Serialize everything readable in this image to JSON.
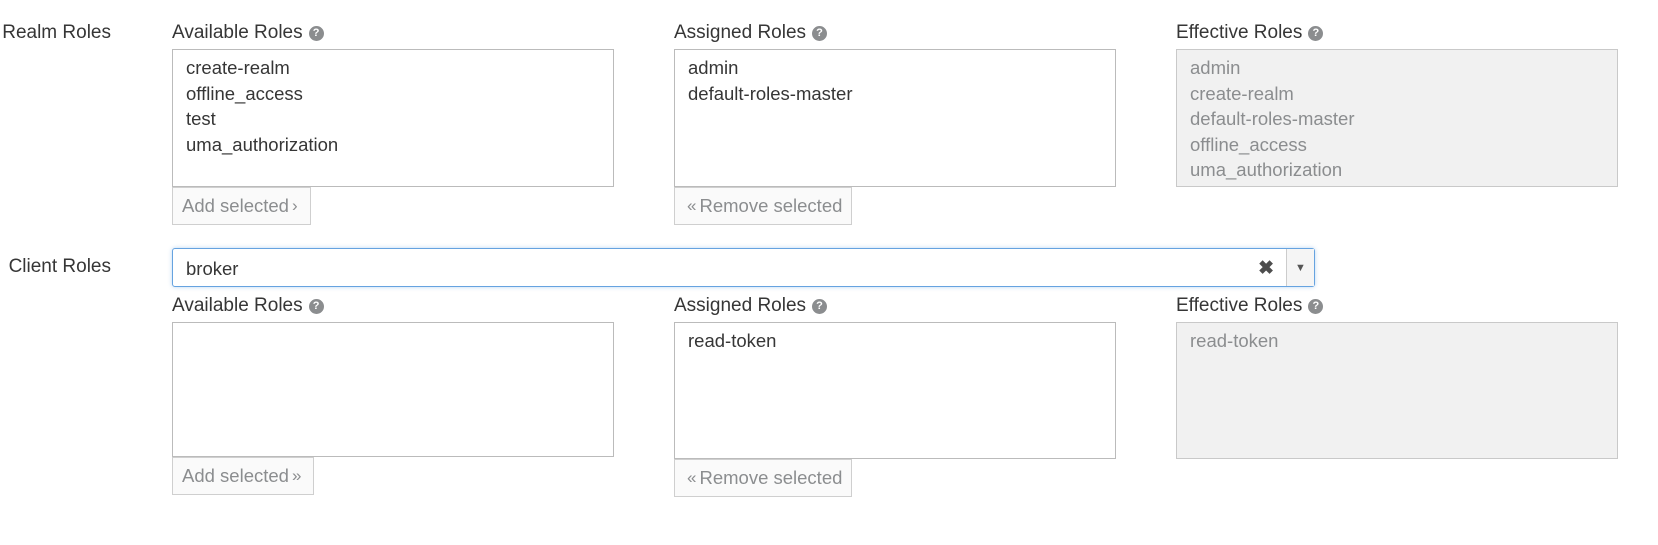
{
  "realm": {
    "row_label": "Realm Roles",
    "available": {
      "label": "Available Roles",
      "items": [
        "create-realm",
        "offline_access",
        "test",
        "uma_authorization"
      ],
      "button": "Add selected",
      "button_chevron": "›"
    },
    "assigned": {
      "label": "Assigned Roles",
      "items": [
        "admin",
        "default-roles-master"
      ],
      "button": "Remove selected",
      "button_chevron": "«"
    },
    "effective": {
      "label": "Effective Roles",
      "items": [
        "admin",
        "create-realm",
        "default-roles-master",
        "offline_access",
        "uma_authorization"
      ]
    }
  },
  "client": {
    "row_label": "Client Roles",
    "select_value": "broker",
    "clear_glyph": "✖",
    "arrow_glyph": "▼",
    "available": {
      "label": "Available Roles",
      "items": [],
      "button": "Add selected",
      "button_chevron": "»"
    },
    "assigned": {
      "label": "Assigned Roles",
      "items": [
        "read-token"
      ],
      "button": "Remove selected",
      "button_chevron": "«"
    },
    "effective": {
      "label": "Effective Roles",
      "items": [
        "read-token"
      ]
    }
  },
  "help_glyph": "?",
  "colors": {
    "text": "#363636",
    "muted": "#8b8d8f",
    "focus_border": "#66a3e0",
    "effective_bg": "#f1f1f1"
  }
}
